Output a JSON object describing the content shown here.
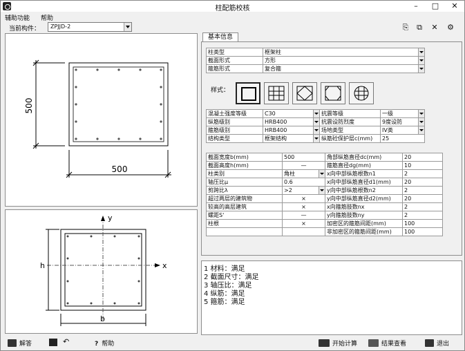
{
  "window": {
    "title": "柱配筋校核"
  },
  "menu": [
    "辅助功能",
    "帮助"
  ],
  "toolbar": {
    "current_label": "当前构件：",
    "current_value": "ZPJJD-2"
  },
  "tab": "基本信息",
  "props1": [
    {
      "label": "柱类型",
      "value": "框架柱"
    },
    {
      "label": "截面形式",
      "value": "方形"
    },
    {
      "label": "箍筋形式",
      "value": "复合箍"
    }
  ],
  "style_label": "样式：",
  "props2": [
    {
      "l1": "混凝土强度等级",
      "v1": "C30",
      "l2": "抗震等级",
      "v2": "一级"
    },
    {
      "l1": "纵筋级别",
      "v1": "HRB400",
      "l2": "抗震设防烈度",
      "v2": "9度设防"
    },
    {
      "l1": "箍筋级别",
      "v1": "HRB400",
      "l2": "场地类型",
      "v2": "IV类"
    },
    {
      "l1": "结构类型",
      "v1": "框架结构",
      "l2": "纵筋砼保护层c(mm)",
      "v2": "25"
    }
  ],
  "props3": [
    {
      "l1": "截面宽度b(mm)",
      "v1": "500",
      "l2": "角部纵筋直径dc(mm)",
      "v2": "20"
    },
    {
      "l1": "截面高度h(mm)",
      "v1": "—",
      "l2": "箍筋直径dg(mm)",
      "v2": "10"
    },
    {
      "l1": "柱类别",
      "v1": "角柱",
      "l2": "x向中部纵筋根数n1",
      "v2": "2"
    },
    {
      "l1": "轴压比μ",
      "v1": "0.6",
      "l2": "x向中部纵筋直径d1(mm)",
      "v2": "20"
    },
    {
      "l1": "剪跨比λ",
      "v1": ">2",
      "l2": "y向中部纵筋根数n2",
      "v2": "2"
    },
    {
      "l1": "超过两层的建筑物",
      "v1": "×",
      "l2": "y向中部纵筋直径d2(mm)",
      "v2": "20"
    },
    {
      "l1": "较高的高层建筑",
      "v1": "×",
      "l2": "x向箍筋肢数nx",
      "v2": "2"
    },
    {
      "l1": "螺距S'",
      "v1": "—",
      "l2": "y向箍筋肢数ny",
      "v2": "2"
    },
    {
      "l1": "柱根",
      "v1": "×",
      "l2": "加密区的箍筋间距(mm)",
      "v2": "100"
    },
    {
      "l1": "",
      "v1": "",
      "l2": "非加密区的箍筋间距(mm)",
      "v2": "100"
    }
  ],
  "results": [
    "1 材料：满足",
    "2 截面尺寸：满足",
    "3 轴压比：满足",
    "4 纵筋：满足",
    "5 箍筋：满足"
  ],
  "drawing": {
    "dim_h": "500",
    "dim_b": "500",
    "axis_x": "x",
    "axis_y": "y",
    "label_h": "h",
    "label_b": "b"
  },
  "bottom": {
    "solve": "解答",
    "help": "帮助",
    "start": "开始计算",
    "view": "结果查看",
    "exit": "退出"
  }
}
